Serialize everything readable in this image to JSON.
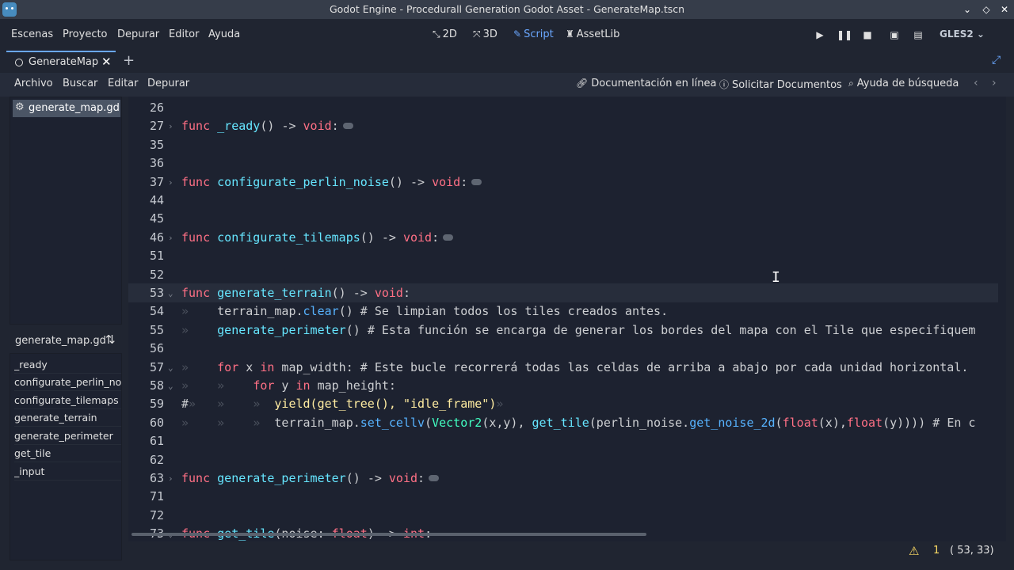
{
  "window": {
    "title": "Godot Engine - Procedurall Generation Godot Asset - GenerateMap.tscn"
  },
  "menu": [
    "Escenas",
    "Proyecto",
    "Depurar",
    "Editor",
    "Ayuda"
  ],
  "workspaces": [
    {
      "label": "2D",
      "icon": "2d-icon"
    },
    {
      "label": "3D",
      "icon": "3d-icon"
    },
    {
      "label": "Script",
      "icon": "script-icon",
      "active": true
    },
    {
      "label": "AssetLib",
      "icon": "assetlib-icon"
    }
  ],
  "renderer": "GLES2",
  "tabs": [
    {
      "label": "GenerateMap"
    }
  ],
  "script_menu": [
    "Archivo",
    "Buscar",
    "Editar",
    "Depurar"
  ],
  "help_links": [
    {
      "label": "Documentación en línea",
      "icon": "link-icon"
    },
    {
      "label": "Solicitar Documentos",
      "icon": "info-icon"
    },
    {
      "label": "Ayuda de búsqueda",
      "icon": "search-help-icon"
    }
  ],
  "scripts": [
    "generate_map.gd"
  ],
  "methods_panel": {
    "title": "generate_map.gd",
    "items": [
      "_ready",
      "configurate_perlin_noise",
      "configurate_tilemaps",
      "generate_terrain",
      "generate_perimeter",
      "get_tile",
      "_input"
    ]
  },
  "lines": [
    {
      "n": "26",
      "fold": "",
      "html": ""
    },
    {
      "n": "27",
      "fold": "›",
      "html": "<span class='kw'>func</span> <span class='fn'>_ready</span>() <span class='tx'>-&gt;</span> <span class='vd'>void</span>:<span class='ellip'></span>"
    },
    {
      "n": "35",
      "fold": "",
      "html": ""
    },
    {
      "n": "36",
      "fold": "",
      "html": ""
    },
    {
      "n": "37",
      "fold": "›",
      "html": "<span class='kw'>func</span> <span class='fn'>configurate_perlin_noise</span>() <span class='tx'>-&gt;</span> <span class='vd'>void</span>:<span class='ellip'></span>"
    },
    {
      "n": "44",
      "fold": "",
      "html": ""
    },
    {
      "n": "45",
      "fold": "",
      "html": ""
    },
    {
      "n": "46",
      "fold": "›",
      "html": "<span class='kw'>func</span> <span class='fn'>configurate_tilemaps</span>() <span class='tx'>-&gt;</span> <span class='vd'>void</span>:<span class='ellip'></span>"
    },
    {
      "n": "51",
      "fold": "",
      "html": ""
    },
    {
      "n": "52",
      "fold": "",
      "html": ""
    },
    {
      "n": "53",
      "fold": "⌄",
      "html": "<span class='kw'>func</span> <span class='fn'>generate_terrain</span>() <span class='tx'>-&gt;</span> <span class='vd'>void</span>:"
    },
    {
      "n": "54",
      "fold": "",
      "html": "<span class='dim'>»  </span>  terrain_map.<span class='fn2'>clear</span>() <span class='cm'># Se limpian todos los tiles creados antes.</span>"
    },
    {
      "n": "55",
      "fold": "",
      "html": "<span class='dim'>»  </span>  <span class='fn'>generate_perimeter</span>() <span class='cm'># Esta función se encarga de generar los bordes del mapa con el Tile que especifiquem</span>"
    },
    {
      "n": "56",
      "fold": "",
      "html": ""
    },
    {
      "n": "57",
      "fold": "⌄",
      "html": "<span class='dim'>»  </span>  <span class='kw'>for</span> x <span class='kw'>in</span> map_width: <span class='cm'># Este bucle recorrerá todas las celdas de arriba a abajo por cada unidad horizontal.</span>"
    },
    {
      "n": "58",
      "fold": "⌄",
      "html": "<span class='dim'>»  </span>  <span class='dim'>»  </span>  <span class='kw'>for</span> y <span class='kw'>in</span> map_height:"
    },
    {
      "n": "59",
      "fold": "",
      "html": "<span class='hash'>#</span><span class='dim'>» </span>  <span class='dim'>»  </span>  <span class='dim'>»  </span><span class='st'>yield(get_tree(), \"idle_frame\")</span><span class='dim'>»</span>"
    },
    {
      "n": "60",
      "fold": "",
      "html": "<span class='dim'>»  </span>  <span class='dim'>»  </span>  <span class='dim'>»  </span>terrain_map.<span class='fn2'>set_cellv</span>(<span class='ty'>Vector2</span>(x,y), <span class='fn'>get_tile</span>(perlin_noise.<span class='fn2'>get_noise_2d</span>(<span class='kw'>float</span>(x),<span class='kw'>float</span>(y)))) <span class='cm'># En c</span>"
    },
    {
      "n": "61",
      "fold": "",
      "html": ""
    },
    {
      "n": "62",
      "fold": "",
      "html": ""
    },
    {
      "n": "63",
      "fold": "›",
      "html": "<span class='kw'>func</span> <span class='fn'>generate_perimeter</span>() <span class='tx'>-&gt;</span> <span class='vd'>void</span>:<span class='ellip'></span>"
    },
    {
      "n": "71",
      "fold": "",
      "html": ""
    },
    {
      "n": "72",
      "fold": "",
      "html": ""
    },
    {
      "n": "73",
      "fold": "⌄",
      "html": "<span class='kw'>func</span> <span class='fn'>get_tile</span>(noise: <span class='kw'>float</span>) <span class='tx'>-&gt;</span> <span class='kw'>int</span>:"
    }
  ],
  "status": {
    "warnings": "1",
    "position": "(  53, 33)"
  }
}
